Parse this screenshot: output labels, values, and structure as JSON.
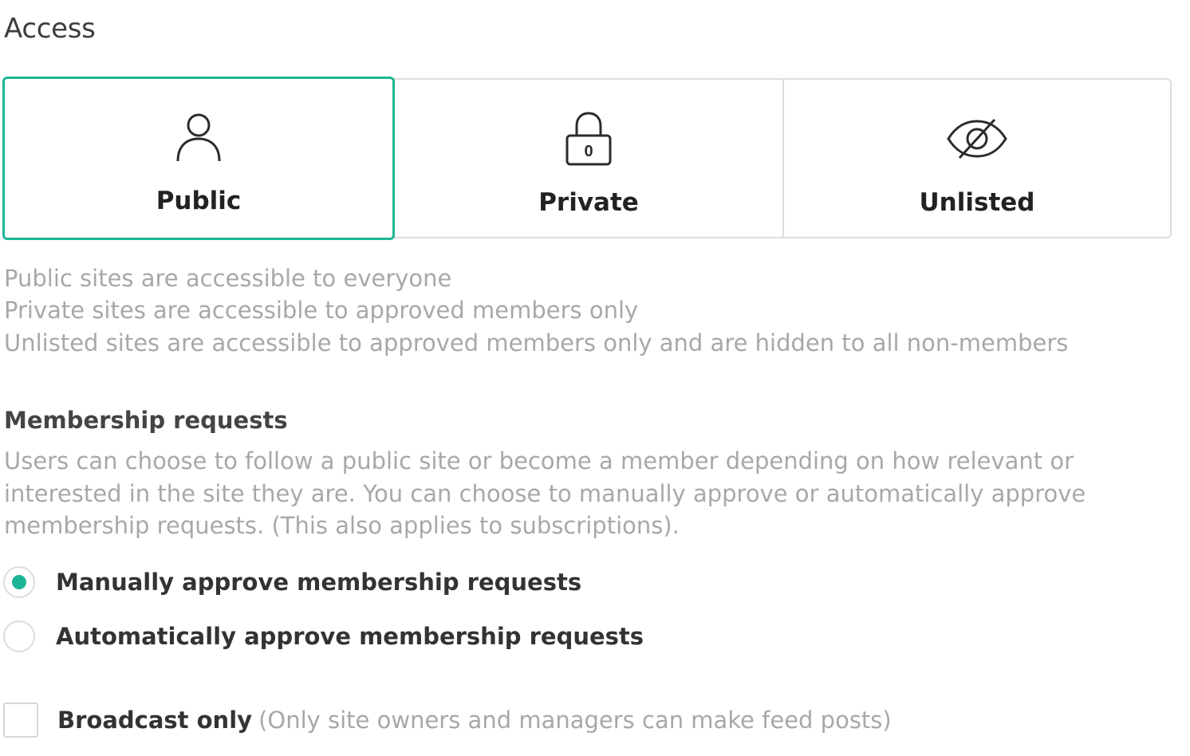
{
  "access": {
    "title": "Access",
    "options": [
      {
        "label": "Public",
        "icon": "person-icon",
        "selected": true
      },
      {
        "label": "Private",
        "icon": "lock-icon",
        "selected": false,
        "icon_text": "0"
      },
      {
        "label": "Unlisted",
        "icon": "eye-slash-icon",
        "selected": false
      }
    ],
    "descriptions": [
      "Public sites are accessible to everyone",
      "Private sites are accessible to approved members only",
      "Unlisted sites are accessible to approved members only and are hidden to all non-members"
    ]
  },
  "membership": {
    "heading": "Membership requests",
    "description": "Users can choose to follow a public site or become a member depending on how relevant or interested in the site they are. You can choose to manually approve or automatically approve membership requests. (This also applies to subscriptions).",
    "options": [
      {
        "label": "Manually approve membership requests",
        "checked": true
      },
      {
        "label": "Automatically approve membership requests",
        "checked": false
      }
    ]
  },
  "broadcast": {
    "label": "Broadcast only",
    "hint": "(Only site owners and managers can make feed posts)",
    "checked": false
  },
  "colors": {
    "accent": "#1eb596",
    "border": "#dddddd",
    "muted_text": "#a8a8a8"
  }
}
